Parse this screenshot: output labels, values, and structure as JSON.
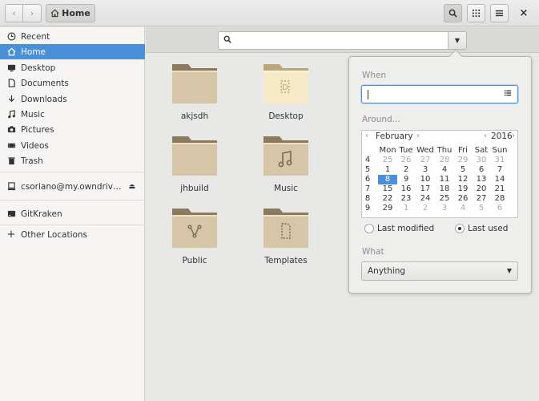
{
  "header": {
    "path_button": "Home",
    "close_glyph": "×"
  },
  "sidebar": {
    "items": [
      {
        "label": "Recent",
        "icon": "clock-icon"
      },
      {
        "label": "Home",
        "icon": "home-icon"
      },
      {
        "label": "Desktop",
        "icon": "desktop-icon"
      },
      {
        "label": "Documents",
        "icon": "document-icon"
      },
      {
        "label": "Downloads",
        "icon": "download-icon"
      },
      {
        "label": "Music",
        "icon": "music-icon"
      },
      {
        "label": "Pictures",
        "icon": "camera-icon"
      },
      {
        "label": "Videos",
        "icon": "video-icon"
      },
      {
        "label": "Trash",
        "icon": "trash-icon"
      },
      {
        "label": "csoriano@my.owndriv…",
        "icon": "network-drive-icon"
      },
      {
        "label": "GitKraken",
        "icon": "drive-icon"
      },
      {
        "label": "Other Locations",
        "icon": "plus-icon"
      }
    ]
  },
  "files": [
    {
      "name": "akjsdh",
      "type": "folder"
    },
    {
      "name": "Desktop",
      "type": "desktop"
    },
    {
      "name": "jhbuild",
      "type": "folder"
    },
    {
      "name": "Music",
      "type": "music"
    },
    {
      "name": "Public",
      "type": "public"
    },
    {
      "name": "Templates",
      "type": "templates"
    }
  ],
  "popover": {
    "when_label": "When",
    "around_label": "Around…",
    "calendar": {
      "month": "February",
      "year": "2016",
      "day_headers": [
        "Mon",
        "Tue",
        "Wed",
        "Thu",
        "Fri",
        "Sat",
        "Sun"
      ],
      "weeks": [
        {
          "wk": "4",
          "days": [
            "25",
            "26",
            "27",
            "28",
            "29",
            "30",
            "31"
          ],
          "dim": [
            true,
            true,
            true,
            true,
            true,
            true,
            true
          ]
        },
        {
          "wk": "5",
          "days": [
            "1",
            "2",
            "3",
            "4",
            "5",
            "6",
            "7"
          ],
          "dim": [
            false,
            false,
            false,
            false,
            false,
            false,
            false
          ]
        },
        {
          "wk": "6",
          "days": [
            "8",
            "9",
            "10",
            "11",
            "12",
            "13",
            "14"
          ],
          "dim": [
            false,
            false,
            false,
            false,
            false,
            false,
            false
          ]
        },
        {
          "wk": "7",
          "days": [
            "15",
            "16",
            "17",
            "18",
            "19",
            "20",
            "21"
          ],
          "dim": [
            false,
            false,
            false,
            false,
            false,
            false,
            false
          ]
        },
        {
          "wk": "8",
          "days": [
            "22",
            "23",
            "24",
            "25",
            "26",
            "27",
            "28"
          ],
          "dim": [
            false,
            false,
            false,
            false,
            false,
            false,
            false
          ]
        },
        {
          "wk": "9",
          "days": [
            "29",
            "1",
            "2",
            "3",
            "4",
            "5",
            "6"
          ],
          "dim": [
            false,
            true,
            true,
            true,
            true,
            true,
            true
          ]
        }
      ],
      "selected_day": "8"
    },
    "radio_last_modified": "Last modified",
    "radio_last_used": "Last used",
    "radio_selected": "Last used",
    "what_label": "What",
    "what_value": "Anything"
  },
  "colors": {
    "accent": "#4a90d9",
    "folder": "#d6c5a6"
  }
}
